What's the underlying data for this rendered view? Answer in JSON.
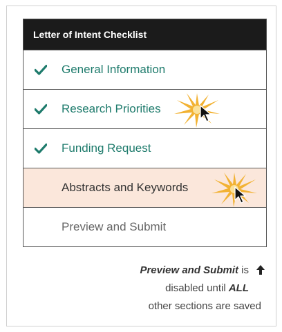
{
  "checklist": {
    "title": "Letter of Intent Checklist",
    "items": [
      {
        "label": "General Information",
        "status": "saved"
      },
      {
        "label": "Research Priorities",
        "status": "saved"
      },
      {
        "label": "Funding Request",
        "status": "saved"
      },
      {
        "label": "Abstracts and Keywords",
        "status": "current"
      },
      {
        "label": "Preview and Submit",
        "status": "disabled"
      }
    ]
  },
  "note": {
    "part1_bold": "Preview and Submit",
    "part2": " is",
    "part3": "disabled until ",
    "part4_bold": "ALL",
    "part5": "other sections are saved"
  },
  "colors": {
    "header_bg": "#1b1b1b",
    "done_text": "#1e7b6c",
    "active_bg": "#fbe7db",
    "sparkle": "#f2b233"
  },
  "icons": {
    "check": "check-icon",
    "cursor": "mouse-cursor-icon",
    "sparkle": "click-sparkle-icon",
    "arrow": "up-arrow-icon"
  }
}
